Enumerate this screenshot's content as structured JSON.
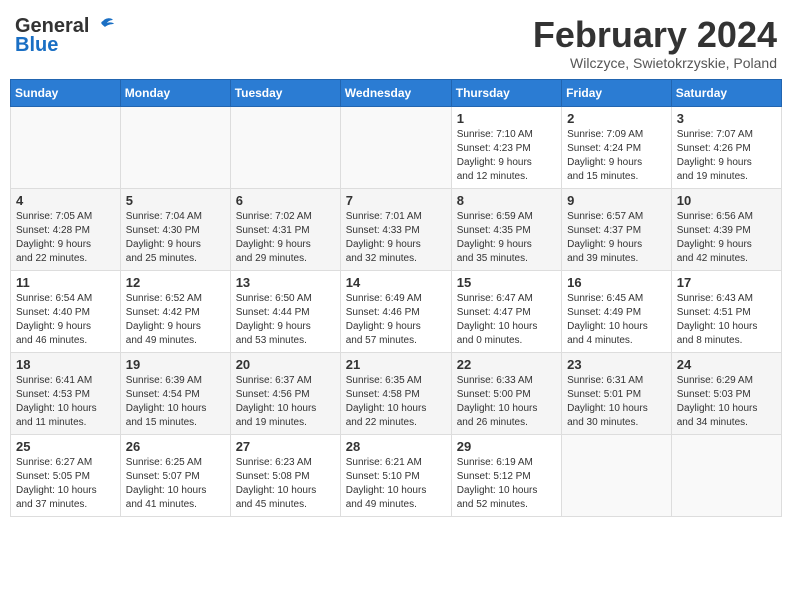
{
  "header": {
    "logo_general": "General",
    "logo_blue": "Blue",
    "month_title": "February 2024",
    "subtitle": "Wilczyce, Swietokrzyskie, Poland"
  },
  "weekdays": [
    "Sunday",
    "Monday",
    "Tuesday",
    "Wednesday",
    "Thursday",
    "Friday",
    "Saturday"
  ],
  "weeks": [
    [
      {
        "day": "",
        "info": ""
      },
      {
        "day": "",
        "info": ""
      },
      {
        "day": "",
        "info": ""
      },
      {
        "day": "",
        "info": ""
      },
      {
        "day": "1",
        "info": "Sunrise: 7:10 AM\nSunset: 4:23 PM\nDaylight: 9 hours\nand 12 minutes."
      },
      {
        "day": "2",
        "info": "Sunrise: 7:09 AM\nSunset: 4:24 PM\nDaylight: 9 hours\nand 15 minutes."
      },
      {
        "day": "3",
        "info": "Sunrise: 7:07 AM\nSunset: 4:26 PM\nDaylight: 9 hours\nand 19 minutes."
      }
    ],
    [
      {
        "day": "4",
        "info": "Sunrise: 7:05 AM\nSunset: 4:28 PM\nDaylight: 9 hours\nand 22 minutes."
      },
      {
        "day": "5",
        "info": "Sunrise: 7:04 AM\nSunset: 4:30 PM\nDaylight: 9 hours\nand 25 minutes."
      },
      {
        "day": "6",
        "info": "Sunrise: 7:02 AM\nSunset: 4:31 PM\nDaylight: 9 hours\nand 29 minutes."
      },
      {
        "day": "7",
        "info": "Sunrise: 7:01 AM\nSunset: 4:33 PM\nDaylight: 9 hours\nand 32 minutes."
      },
      {
        "day": "8",
        "info": "Sunrise: 6:59 AM\nSunset: 4:35 PM\nDaylight: 9 hours\nand 35 minutes."
      },
      {
        "day": "9",
        "info": "Sunrise: 6:57 AM\nSunset: 4:37 PM\nDaylight: 9 hours\nand 39 minutes."
      },
      {
        "day": "10",
        "info": "Sunrise: 6:56 AM\nSunset: 4:39 PM\nDaylight: 9 hours\nand 42 minutes."
      }
    ],
    [
      {
        "day": "11",
        "info": "Sunrise: 6:54 AM\nSunset: 4:40 PM\nDaylight: 9 hours\nand 46 minutes."
      },
      {
        "day": "12",
        "info": "Sunrise: 6:52 AM\nSunset: 4:42 PM\nDaylight: 9 hours\nand 49 minutes."
      },
      {
        "day": "13",
        "info": "Sunrise: 6:50 AM\nSunset: 4:44 PM\nDaylight: 9 hours\nand 53 minutes."
      },
      {
        "day": "14",
        "info": "Sunrise: 6:49 AM\nSunset: 4:46 PM\nDaylight: 9 hours\nand 57 minutes."
      },
      {
        "day": "15",
        "info": "Sunrise: 6:47 AM\nSunset: 4:47 PM\nDaylight: 10 hours\nand 0 minutes."
      },
      {
        "day": "16",
        "info": "Sunrise: 6:45 AM\nSunset: 4:49 PM\nDaylight: 10 hours\nand 4 minutes."
      },
      {
        "day": "17",
        "info": "Sunrise: 6:43 AM\nSunset: 4:51 PM\nDaylight: 10 hours\nand 8 minutes."
      }
    ],
    [
      {
        "day": "18",
        "info": "Sunrise: 6:41 AM\nSunset: 4:53 PM\nDaylight: 10 hours\nand 11 minutes."
      },
      {
        "day": "19",
        "info": "Sunrise: 6:39 AM\nSunset: 4:54 PM\nDaylight: 10 hours\nand 15 minutes."
      },
      {
        "day": "20",
        "info": "Sunrise: 6:37 AM\nSunset: 4:56 PM\nDaylight: 10 hours\nand 19 minutes."
      },
      {
        "day": "21",
        "info": "Sunrise: 6:35 AM\nSunset: 4:58 PM\nDaylight: 10 hours\nand 22 minutes."
      },
      {
        "day": "22",
        "info": "Sunrise: 6:33 AM\nSunset: 5:00 PM\nDaylight: 10 hours\nand 26 minutes."
      },
      {
        "day": "23",
        "info": "Sunrise: 6:31 AM\nSunset: 5:01 PM\nDaylight: 10 hours\nand 30 minutes."
      },
      {
        "day": "24",
        "info": "Sunrise: 6:29 AM\nSunset: 5:03 PM\nDaylight: 10 hours\nand 34 minutes."
      }
    ],
    [
      {
        "day": "25",
        "info": "Sunrise: 6:27 AM\nSunset: 5:05 PM\nDaylight: 10 hours\nand 37 minutes."
      },
      {
        "day": "26",
        "info": "Sunrise: 6:25 AM\nSunset: 5:07 PM\nDaylight: 10 hours\nand 41 minutes."
      },
      {
        "day": "27",
        "info": "Sunrise: 6:23 AM\nSunset: 5:08 PM\nDaylight: 10 hours\nand 45 minutes."
      },
      {
        "day": "28",
        "info": "Sunrise: 6:21 AM\nSunset: 5:10 PM\nDaylight: 10 hours\nand 49 minutes."
      },
      {
        "day": "29",
        "info": "Sunrise: 6:19 AM\nSunset: 5:12 PM\nDaylight: 10 hours\nand 52 minutes."
      },
      {
        "day": "",
        "info": ""
      },
      {
        "day": "",
        "info": ""
      }
    ]
  ]
}
